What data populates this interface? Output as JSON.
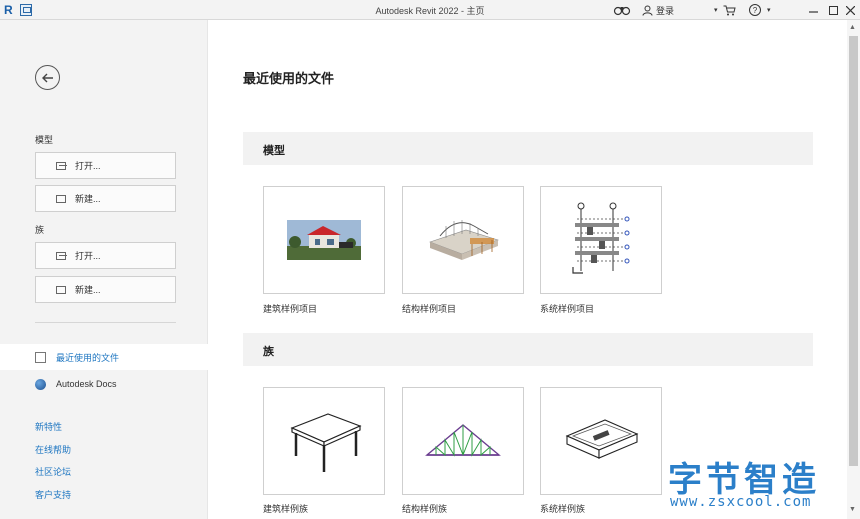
{
  "window": {
    "title": "Autodesk Revit 2022 - 主页",
    "login_label": "登录",
    "help_symbol": "?",
    "dropdown_symbol": "▾"
  },
  "sidebar": {
    "model_section": "模型",
    "model_open": "打开...",
    "model_new": "新建...",
    "family_section": "族",
    "family_open": "打开...",
    "family_new": "新建...",
    "nav_recent": "最近使用的文件",
    "nav_docs": "Autodesk Docs",
    "links": [
      "新特性",
      "在线帮助",
      "社区论坛",
      "客户支持"
    ]
  },
  "main": {
    "title": "最近使用的文件",
    "models_header": "模型",
    "families_header": "族",
    "models": [
      {
        "label": "建筑样例项目",
        "thumb": "architecture-render"
      },
      {
        "label": "结构样例项目",
        "thumb": "structure-frame"
      },
      {
        "label": "系统样例项目",
        "thumb": "mep-systems"
      }
    ],
    "families": [
      {
        "label": "建筑样例族",
        "thumb": "table-icon"
      },
      {
        "label": "结构样例族",
        "thumb": "truss-icon"
      },
      {
        "label": "系统样例族",
        "thumb": "tray-icon"
      }
    ]
  },
  "watermark": {
    "cn": "字节智造",
    "en": "www.zsxcool.com"
  },
  "colors": {
    "accent": "#1e76c1",
    "sidebar_bg": "#f3f3f3",
    "section_bg": "#f2f2f2"
  }
}
